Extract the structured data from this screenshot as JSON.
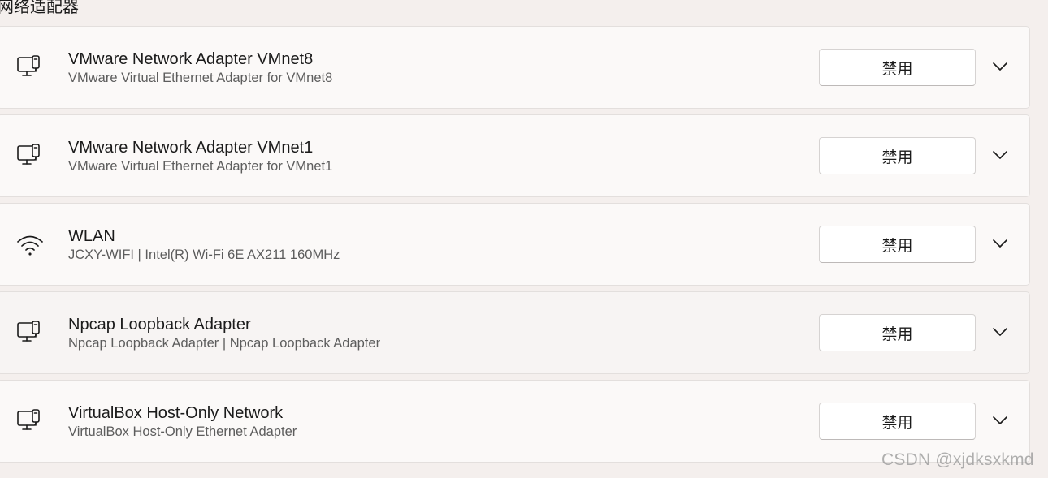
{
  "section": {
    "title": "网络适配器"
  },
  "adapters": [
    {
      "icon": "network-adapter-icon",
      "name": "VMware Network Adapter VMnet8",
      "description": "VMware Virtual Ethernet Adapter for VMnet8",
      "button_label": "禁用"
    },
    {
      "icon": "network-adapter-icon",
      "name": "VMware Network Adapter VMnet1",
      "description": "VMware Virtual Ethernet Adapter for VMnet1",
      "button_label": "禁用"
    },
    {
      "icon": "wifi-icon",
      "name": "WLAN",
      "description": "JCXY-WIFI | Intel(R) Wi-Fi 6E AX211 160MHz",
      "button_label": "禁用"
    },
    {
      "icon": "network-adapter-icon",
      "name": "Npcap Loopback Adapter",
      "description": "Npcap Loopback Adapter | Npcap Loopback Adapter",
      "button_label": "禁用"
    },
    {
      "icon": "network-adapter-icon",
      "name": "VirtualBox Host-Only Network",
      "description": "VirtualBox Host-Only Ethernet Adapter",
      "button_label": "禁用"
    }
  ],
  "watermark": "CSDN @xjdksxkmd",
  "colors": {
    "background": "#f4efed",
    "card": "#fbf9f8",
    "card_hover": "#f7f4f3",
    "card_border": "#e3dfdd",
    "button": "#ffffff",
    "secondary_text": "#5d5d5d"
  }
}
